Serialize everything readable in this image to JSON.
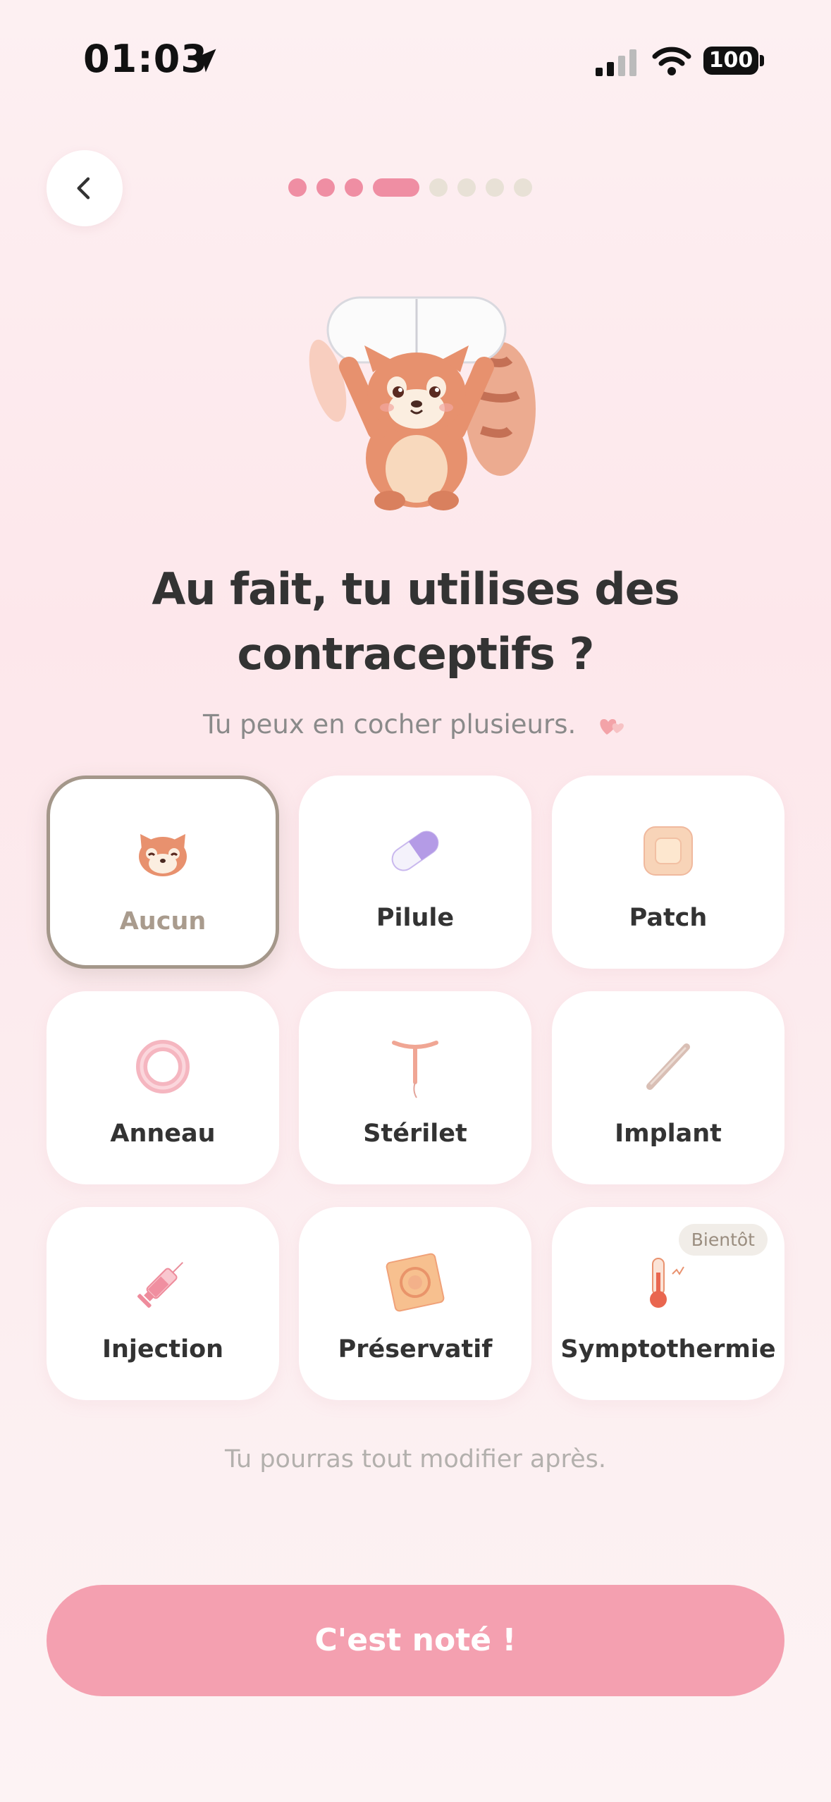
{
  "status": {
    "time": "01:03",
    "battery": "100"
  },
  "progress": {
    "total_steps": 8,
    "current_step": 4
  },
  "title_line1": "Au fait, tu utilises des",
  "title_line2": "contraceptifs ?",
  "subtitle": "Tu peux en cocher plusieurs.",
  "options": [
    {
      "label": "Aucun",
      "selected": true,
      "icon": "red-panda-face-icon"
    },
    {
      "label": "Pilule",
      "selected": false,
      "icon": "pill-capsule-icon"
    },
    {
      "label": "Patch",
      "selected": false,
      "icon": "patch-icon"
    },
    {
      "label": "Anneau",
      "selected": false,
      "icon": "ring-icon"
    },
    {
      "label": "Stérilet",
      "selected": false,
      "icon": "iud-icon"
    },
    {
      "label": "Implant",
      "selected": false,
      "icon": "implant-rod-icon"
    },
    {
      "label": "Injection",
      "selected": false,
      "icon": "syringe-icon"
    },
    {
      "label": "Préservatif",
      "selected": false,
      "icon": "condom-icon"
    },
    {
      "label": "Symptothermie",
      "selected": false,
      "icon": "thermometer-icon",
      "badge": "Bientôt"
    }
  ],
  "footnote": "Tu pourras tout modifier après.",
  "cta_label": "C'est noté !",
  "colors": {
    "accent": "#ef8ea3",
    "cta": "#f4a0b0",
    "selected_border": "#a4978a"
  }
}
